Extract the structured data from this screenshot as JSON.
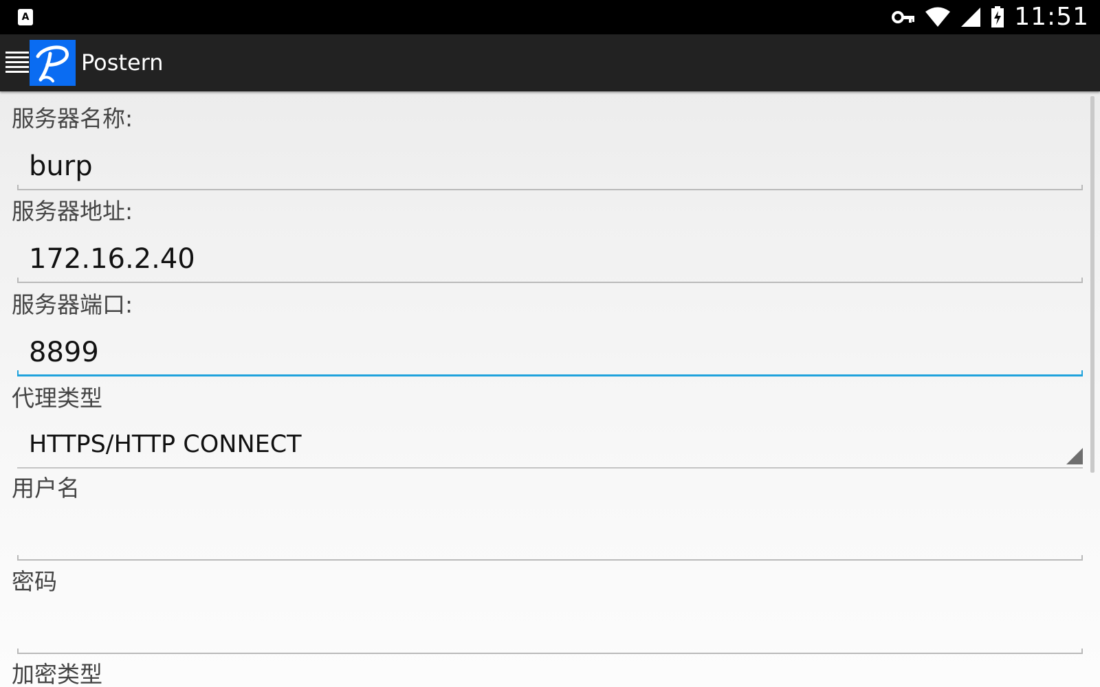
{
  "status_bar": {
    "notification_icon": "a-icon",
    "notification_glyph": "A",
    "icons": [
      "vpn-key-icon",
      "wifi-icon",
      "cell-signal-icon",
      "battery-charging-icon"
    ],
    "time": "11:51"
  },
  "action_bar": {
    "title": "Postern",
    "drawer_icon": "hamburger-menu-icon",
    "logo_icon": "postern-logo-icon",
    "logo_color": "#0a6cf2"
  },
  "form": {
    "server_name": {
      "label": "服务器名称:",
      "value": "burp"
    },
    "server_address": {
      "label": "服务器地址:",
      "value": "172.16.2.40"
    },
    "server_port": {
      "label": "服务器端口:",
      "value": "8899"
    },
    "proxy_type": {
      "label": "代理类型",
      "selected": "HTTPS/HTTP CONNECT"
    },
    "username": {
      "label": "用户名",
      "value": ""
    },
    "password": {
      "label": "密码",
      "value": ""
    },
    "encryption_type": {
      "label": "加密类型"
    }
  },
  "colors": {
    "focus_accent": "#1fa2dc",
    "action_bar": "#222222",
    "status_bar": "#000000"
  }
}
